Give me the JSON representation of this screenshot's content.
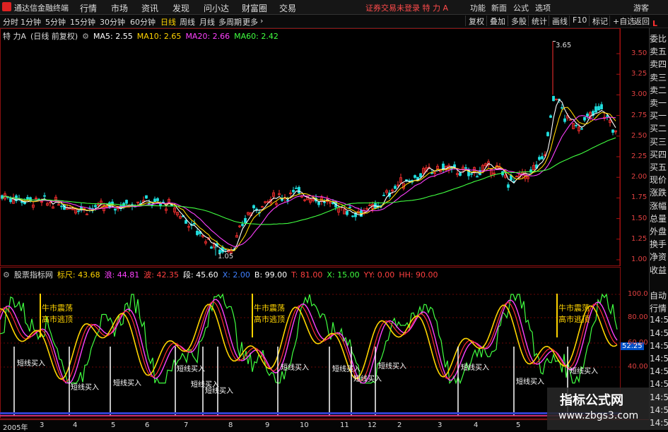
{
  "menubar": {
    "app_title": "通达信金融终端",
    "items": [
      "行情",
      "市场",
      "资讯",
      "发现",
      "问小达",
      "财富圈",
      "交易"
    ],
    "notice": "证券交易未登录  特 力 A",
    "right_items": [
      "功能",
      "新面",
      "公式",
      "选项"
    ],
    "guest": "游客"
  },
  "toolbar": {
    "periods": [
      "分时",
      "1分钟",
      "5分钟",
      "15分钟",
      "30分钟",
      "60分钟",
      "日线",
      "周线",
      "月线",
      "多周期",
      "更多"
    ],
    "active_period": "日线",
    "buttons": [
      "复权",
      "叠加",
      "多股",
      "统计",
      "画线",
      "F10",
      "标记",
      "+自选",
      "返回"
    ]
  },
  "main_chart": {
    "title": "特 力A",
    "subtitle": "(日线 前复权)",
    "ma": [
      {
        "label": "MA5: 2.55",
        "color": "#ffffff"
      },
      {
        "label": "MA10: 2.65",
        "color": "#ffd400"
      },
      {
        "label": "MA20: 2.66",
        "color": "#ff40ff"
      },
      {
        "label": "MA60: 2.42",
        "color": "#40ff40"
      }
    ],
    "high_label": "3.65",
    "low_label": "1.05",
    "y_ticks": [
      "3.50",
      "3.25",
      "3.00",
      "2.75",
      "2.50",
      "2.25",
      "2.00",
      "1.75",
      "1.50",
      "1.25",
      "1.00"
    ],
    "corner": "L"
  },
  "indicator": {
    "name": "股票指标网",
    "values": [
      {
        "label": "标尺: 43.68",
        "color": "#ffd400"
      },
      {
        "label": "浪: 44.81",
        "color": "#ff40ff"
      },
      {
        "label": "波: 42.35",
        "color": "#ff4040"
      },
      {
        "label": "段: 45.60",
        "color": "#ffffff"
      },
      {
        "label": "X: 2.00",
        "color": "#4080ff"
      },
      {
        "label": "B: 99.00",
        "color": "#ffffff"
      },
      {
        "label": "T: 81.00",
        "color": "#ff4040"
      },
      {
        "label": "X: 15.00",
        "color": "#40ff40"
      },
      {
        "label": "YY: 0.00",
        "color": "#ff4040"
      },
      {
        "label": "HH: 90.00",
        "color": "#ff4040"
      }
    ],
    "y_ticks": [
      "100.0",
      "80.00",
      "60.00",
      "40.00"
    ],
    "current_value": "52.25",
    "annotations": {
      "bull": "牛市震荡",
      "escape": "高市逃顶",
      "buy": "短线买入"
    }
  },
  "side_panel": [
    "委比",
    "卖五",
    "卖四",
    "卖三",
    "卖二",
    "卖一",
    "买一",
    "买二",
    "买三",
    "买四",
    "买五",
    "现价",
    "涨跌",
    "涨幅",
    "总量",
    "外盘",
    "换手",
    "净资",
    "收益",
    "",
    "自动",
    "行情",
    "14:50",
    "14:50",
    "14:50",
    "14:50",
    "14:50",
    "14:50",
    "14:50",
    "14:50",
    "14:50"
  ],
  "x_axis": [
    "2005年",
    "3",
    "4",
    "5",
    "6",
    "7",
    "8",
    "9",
    "10",
    "11",
    "12",
    "2",
    "3",
    "4",
    "5"
  ],
  "watermark": {
    "title": "指标公式网",
    "url": "www.zbgs3.com"
  }
}
